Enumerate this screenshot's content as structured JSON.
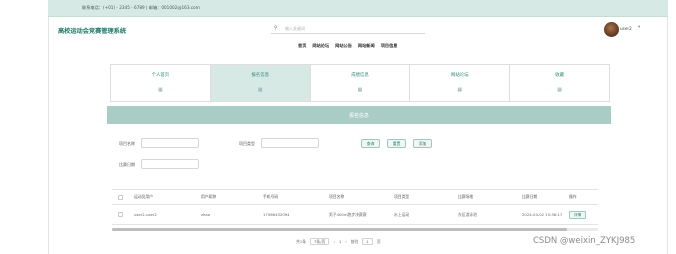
{
  "topbar": {
    "text": "联系电话：(+01) - 2345 - 6789 | 邮箱：001002@163.com"
  },
  "site": {
    "title": "高校运动会竞赛管理系统"
  },
  "search": {
    "icon": "search-icon",
    "placeholder": "输入关键词"
  },
  "user": {
    "name": "user2",
    "arrow": "▾"
  },
  "nav": {
    "items": [
      "首页",
      "网站论坛",
      "网站公告",
      "网站新闻",
      "项目信息"
    ]
  },
  "cards": [
    {
      "label": "个人首页",
      "icon": "▦"
    },
    {
      "label": "报名信息",
      "icon": "▦"
    },
    {
      "label": "成绩信息",
      "icon": "▦"
    },
    {
      "label": "网站论坛",
      "icon": "▦"
    },
    {
      "label": "收藏",
      "icon": "▦"
    }
  ],
  "banner": {
    "title": "报名信息"
  },
  "filters": {
    "project_name_label": "项目名称",
    "project_type_label": "项目类型",
    "match_date_label": "比赛日期",
    "search_btn": "查询",
    "reset_btn": "重置",
    "add_btn": "添加"
  },
  "table": {
    "headers": [
      "",
      "运动员用户",
      "用户昵称",
      "手机号码",
      "项目名称",
      "项目类型",
      "比赛场地",
      "比赛日期",
      "操作"
    ],
    "rows": [
      [
        "",
        "user2-user2",
        "zhao",
        "17566432094",
        "男子400m跑步决赛赛",
        "水上运动",
        "东区游泳池",
        "2024-04-02 15:36:17",
        "详情"
      ]
    ]
  },
  "pager": {
    "total": "共1条",
    "page_size": "7条/页",
    "prev": "‹",
    "page": "1",
    "next": "›",
    "goto_label": "前往",
    "goto_value": "1",
    "page_unit": "页"
  },
  "watermark": {
    "text": "CSDN @weixin_ZYKJ985"
  }
}
